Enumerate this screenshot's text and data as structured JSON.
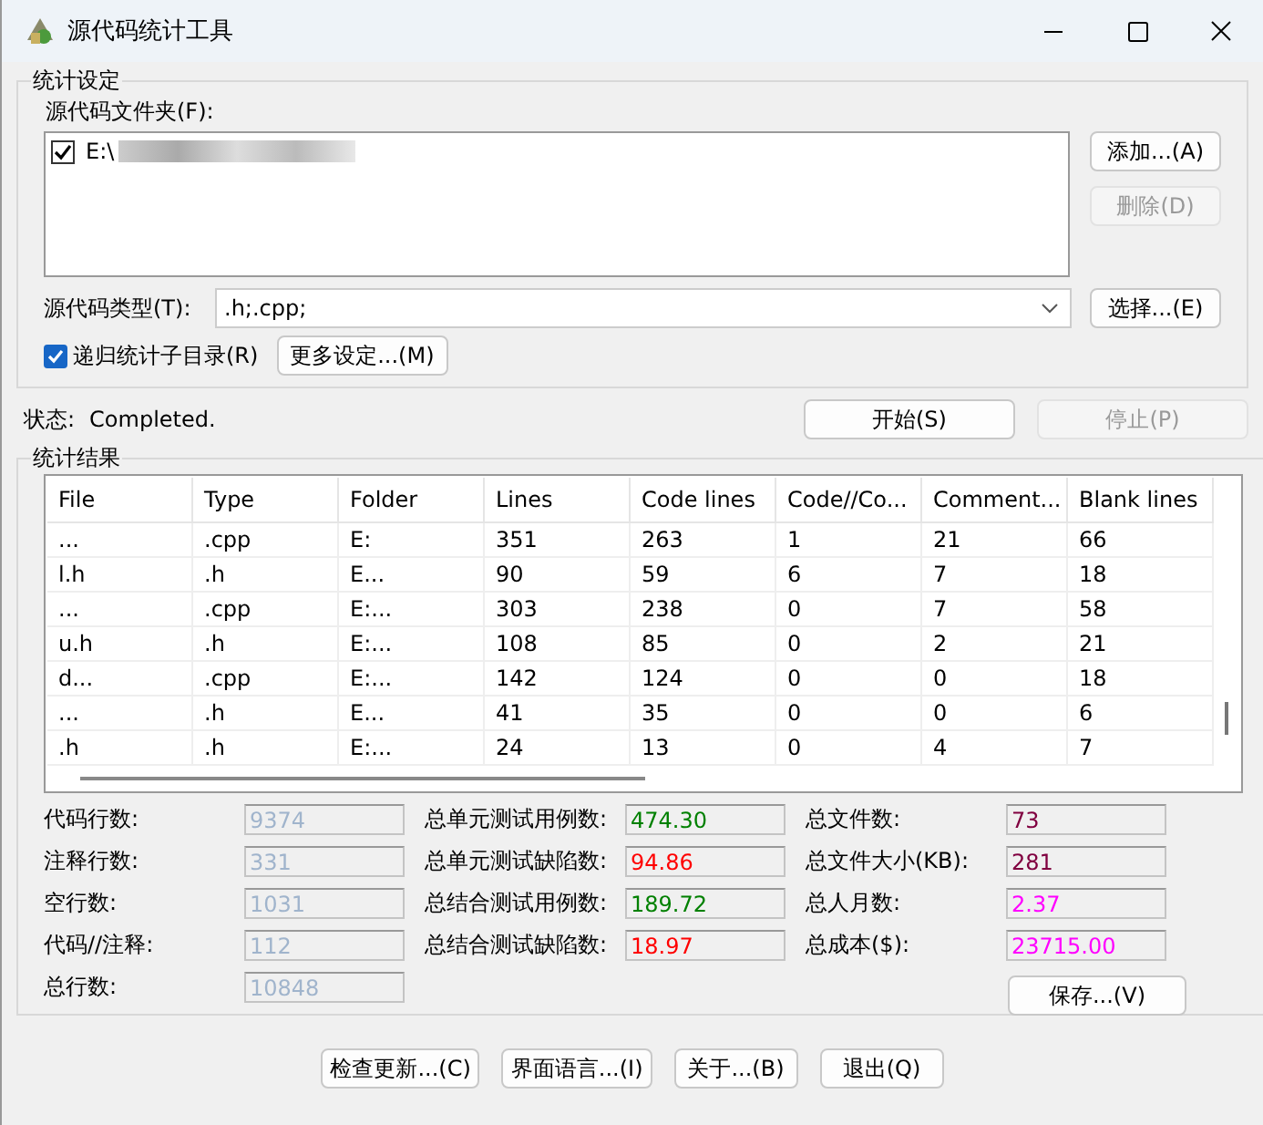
{
  "window": {
    "title": "源代码统计工具"
  },
  "settings": {
    "title": "统计设定",
    "folder_label": "源代码文件夹(F):",
    "folders": [
      {
        "path": "E:\\",
        "checked": true
      }
    ],
    "add_button": {
      "label": "添加...(A)",
      "disabled": false
    },
    "remove_button": {
      "label": "删除(D)",
      "disabled": true
    },
    "type_label": "源代码类型(T):",
    "type_value": ".h;.cpp;",
    "choose_button": {
      "label": "选择...(E)",
      "disabled": false
    },
    "recursive": {
      "label": "递归统计子目录(R)",
      "checked": true
    },
    "more_button": {
      "label": "更多设定...(M)",
      "disabled": false
    }
  },
  "status": {
    "label": "状态:",
    "value": "Completed."
  },
  "start_button": {
    "label": "开始(S)",
    "disabled": false
  },
  "stop_button": {
    "label": "停止(P)",
    "disabled": true
  },
  "results": {
    "title": "统计结果",
    "columns": [
      "File",
      "Type",
      "Folder",
      "Lines",
      "Code lines",
      "Code//Co...",
      "Comment...",
      "Blank lines"
    ],
    "rows": [
      [
        "...",
        ".cpp",
        "E:",
        "351",
        "263",
        "1",
        "21",
        "66"
      ],
      [
        "l.h",
        ".h",
        "E...",
        "90",
        "59",
        "6",
        "7",
        "18"
      ],
      [
        "...",
        ".cpp",
        "E:...",
        "303",
        "238",
        "0",
        "7",
        "58"
      ],
      [
        "u.h",
        ".h",
        "E:...",
        "108",
        "85",
        "0",
        "2",
        "21"
      ],
      [
        "d...",
        ".cpp",
        "E:...",
        "142",
        "124",
        "0",
        "0",
        "18"
      ],
      [
        "...",
        ".h",
        "E...",
        "41",
        "35",
        "0",
        "0",
        "6"
      ],
      [
        ".h",
        ".h",
        "E:...",
        "24",
        "13",
        "0",
        "4",
        "7"
      ]
    ],
    "stats": [
      {
        "label": "代码行数:",
        "value": "9374",
        "color": "#a0b4cc"
      },
      {
        "label": "总单元测试用例数:",
        "value": "474.30",
        "color": "#008000"
      },
      {
        "label": "总文件数:",
        "value": "73",
        "color": "#800040"
      },
      {
        "label": "注释行数:",
        "value": "331",
        "color": "#a0b4cc"
      },
      {
        "label": "总单元测试缺陷数:",
        "value": "94.86",
        "color": "#ff0000"
      },
      {
        "label": "总文件大小(KB):",
        "value": "281",
        "color": "#800040"
      },
      {
        "label": "空行数:",
        "value": "1031",
        "color": "#a0b4cc"
      },
      {
        "label": "总结合测试用例数:",
        "value": "189.72",
        "color": "#008000"
      },
      {
        "label": "总人月数:",
        "value": "2.37",
        "color": "#ff00ff"
      },
      {
        "label": "代码//注释:",
        "value": "112",
        "color": "#a0b4cc"
      },
      {
        "label": "总结合测试缺陷数:",
        "value": "18.97",
        "color": "#ff0000"
      },
      {
        "label": "总成本($):",
        "value": "23715.00",
        "color": "#ff00ff"
      },
      {
        "label": "总行数:",
        "value": "10848",
        "color": "#a0b4cc"
      }
    ],
    "save_button": {
      "label": "保存...(V)",
      "disabled": false
    }
  },
  "bottom_buttons": [
    {
      "label": "检查更新...(C)",
      "disabled": false
    },
    {
      "label": "界面语言...(I)",
      "disabled": false
    },
    {
      "label": "关于...(B)",
      "disabled": false
    },
    {
      "label": "退出(Q)",
      "disabled": false
    }
  ]
}
